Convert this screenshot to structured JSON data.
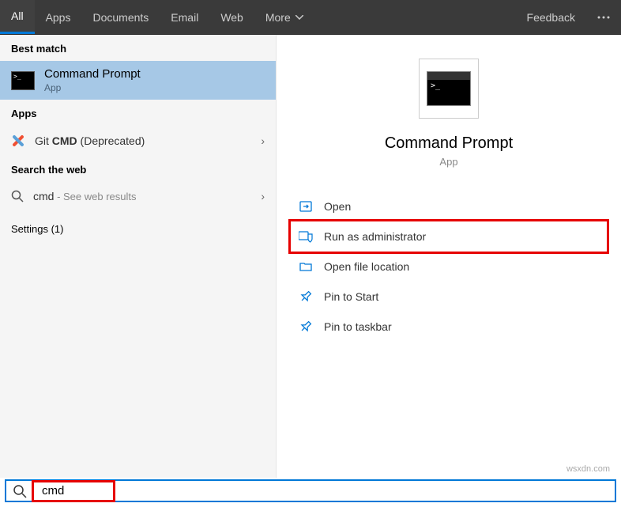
{
  "topbar": {
    "tabs": [
      "All",
      "Apps",
      "Documents",
      "Email",
      "Web",
      "More"
    ],
    "active_index": 0,
    "feedback": "Feedback"
  },
  "left": {
    "best_match_header": "Best match",
    "best_match": {
      "title": "Command Prompt",
      "subtitle": "App"
    },
    "apps_header": "Apps",
    "apps": {
      "git_label_prefix": "Git ",
      "git_label_bold": "CMD",
      "git_label_suffix": " (Deprecated)"
    },
    "search_web_header": "Search the web",
    "search_web": {
      "query": "cmd",
      "suffix": " - See web results"
    },
    "settings_header": "Settings (1)"
  },
  "preview": {
    "title": "Command Prompt",
    "subtitle": "App",
    "actions": {
      "open": "Open",
      "run_admin": "Run as administrator",
      "open_location": "Open file location",
      "pin_start": "Pin to Start",
      "pin_taskbar": "Pin to taskbar"
    }
  },
  "search": {
    "value": "cmd"
  },
  "watermark": "wsxdn.com"
}
